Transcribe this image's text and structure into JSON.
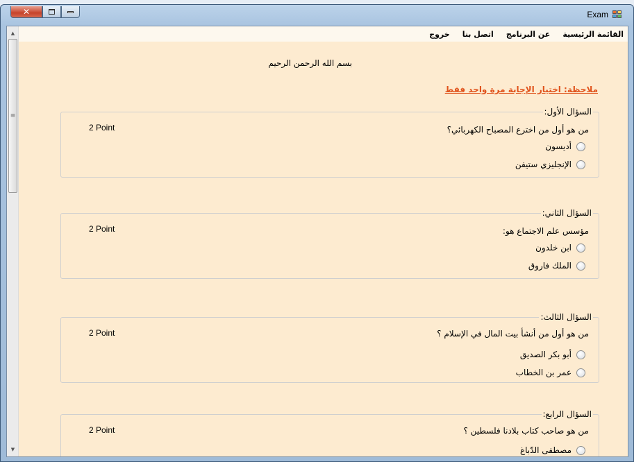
{
  "window": {
    "title": "Exam",
    "close_glyph": "✕"
  },
  "menu": {
    "items": [
      "القائمة الرئيسية",
      "عن البرنامج",
      "اتصل بنا",
      "خروج"
    ]
  },
  "header": {
    "basmala": "بسم الله الرحمن الرحيم",
    "note": "ملاحظة: اختيار الإجابة مرة واحد فقط"
  },
  "questions": [
    {
      "title": "السؤال الأول:",
      "text": "من هو أول من اخترع المصباح الكهربائي؟",
      "points": "2 Point",
      "options": [
        "أديسون",
        "الإنجليزي ستيفن"
      ]
    },
    {
      "title": "السؤال الثاني:",
      "text": "مؤسس علم الاجتماع هو:",
      "points": "2 Point",
      "options": [
        "ابن خلدون",
        "الملك فاروق"
      ]
    },
    {
      "title": "السؤال الثالث:",
      "text": "من هو أول من أنشأ بيت المال في الإسلام ؟",
      "points": "2 Point",
      "options": [
        "أبو بكر الصديق",
        "عمر بن الخطاب"
      ]
    },
    {
      "title": "السؤال الرابع:",
      "text": "من هو صاحب كتاب بلادنا فلسطين ؟",
      "points": "2 Point",
      "options": [
        "مصطفى الدّباغ"
      ]
    }
  ],
  "colors": {
    "background": "#fdebd0",
    "note": "#e0531c"
  }
}
